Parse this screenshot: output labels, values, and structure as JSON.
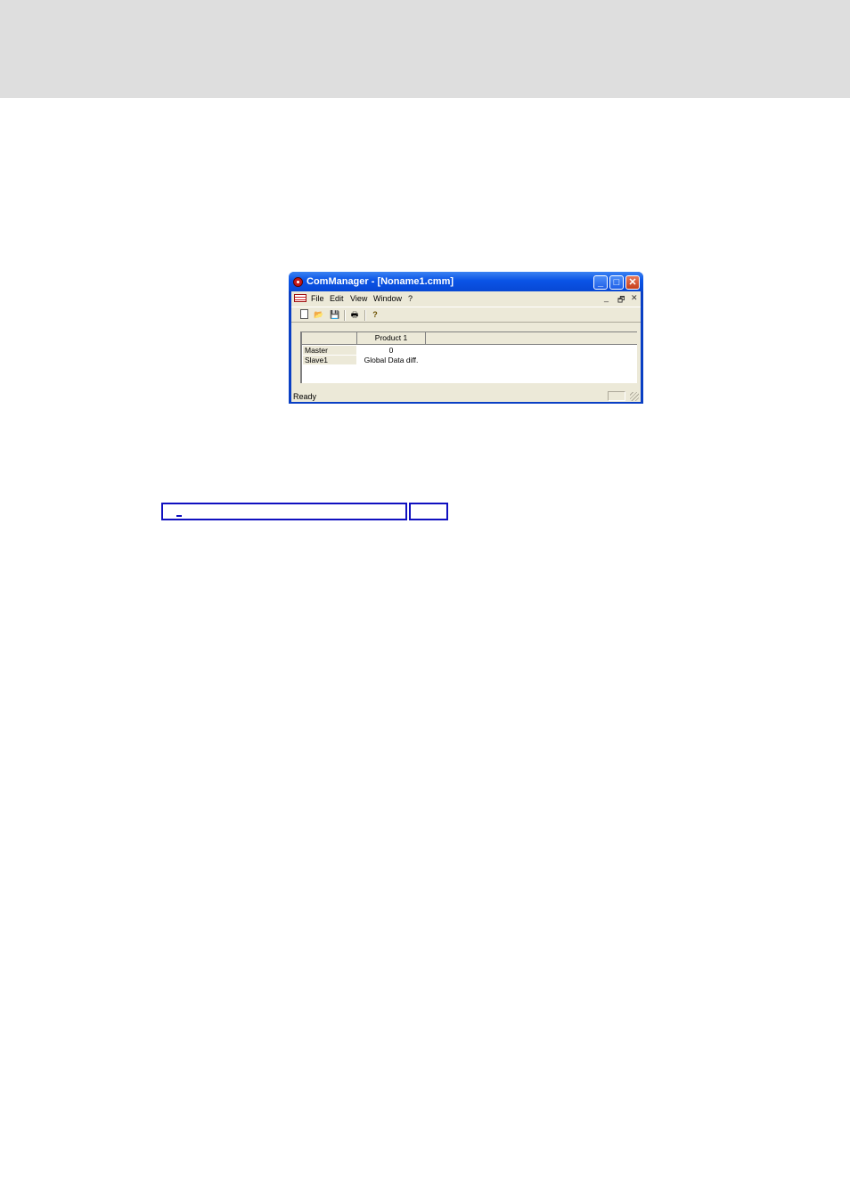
{
  "window": {
    "title": "ComManager - [Noname1.cmm]",
    "controls": {
      "minimize": "_",
      "maximize": "□",
      "close": "✕"
    },
    "accent": "#0a54e6"
  },
  "menu": {
    "items": [
      "File",
      "Edit",
      "View",
      "Window",
      "?"
    ],
    "mdi_controls": [
      "_",
      "🗗",
      "✕"
    ]
  },
  "toolbar": {
    "icons": [
      "new-document-icon",
      "open-folder-icon",
      "save-icon",
      "print-icon",
      "help-icon"
    ],
    "open_glyph": "📂",
    "save_glyph": "💾",
    "print_glyph": "🖶",
    "help_glyph": "?"
  },
  "grid": {
    "header": "Product 1",
    "rows": [
      {
        "label": "Master",
        "value": "0"
      },
      {
        "label": "Slave1",
        "value": "Global Data diff."
      }
    ]
  },
  "status": {
    "text": "Ready"
  }
}
